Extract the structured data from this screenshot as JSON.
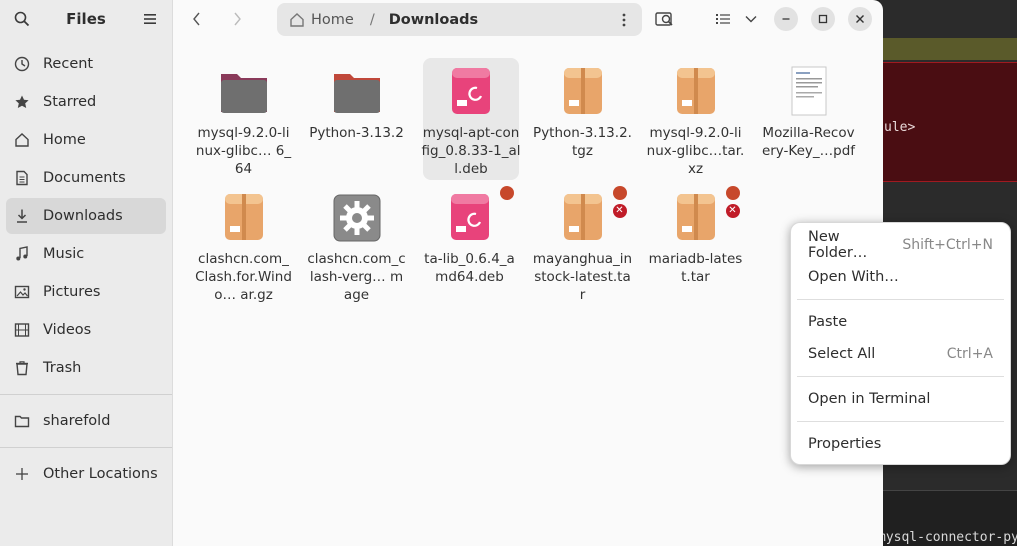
{
  "app": {
    "title": "Files"
  },
  "sidebar": {
    "items": [
      {
        "label": "Recent",
        "icon": "clock-icon"
      },
      {
        "label": "Starred",
        "icon": "star-icon"
      },
      {
        "label": "Home",
        "icon": "home-icon"
      },
      {
        "label": "Documents",
        "icon": "document-icon"
      },
      {
        "label": "Downloads",
        "icon": "download-icon",
        "active": true
      },
      {
        "label": "Music",
        "icon": "music-icon"
      },
      {
        "label": "Pictures",
        "icon": "picture-icon"
      },
      {
        "label": "Videos",
        "icon": "video-icon"
      },
      {
        "label": "Trash",
        "icon": "trash-icon"
      }
    ],
    "bookmarks": [
      {
        "label": "sharefold",
        "icon": "folder-icon"
      }
    ],
    "other": {
      "label": "Other Locations",
      "icon": "plus-icon"
    }
  },
  "path": {
    "home": "Home",
    "separator": "/",
    "current": "Downloads"
  },
  "files": [
    {
      "name": "mysql-9.2.0-linux-glibc… 6_64",
      "icon": "folder-icon",
      "type": "folder"
    },
    {
      "name": "Python-3.13.2",
      "icon": "folder-icon",
      "type": "folder"
    },
    {
      "name": "mysql-apt-config_0.8.33-1_all.deb",
      "icon": "deb-package-icon",
      "type": "deb",
      "selected": true
    },
    {
      "name": "Python-3.13.2.tgz",
      "icon": "archive-icon",
      "type": "archive"
    },
    {
      "name": "mysql-9.2.0-linux-glibc…tar.xz",
      "icon": "archive-icon",
      "type": "archive"
    },
    {
      "name": "Mozilla-Recovery-Key_…pdf",
      "icon": "pdf-document-icon",
      "type": "pdf"
    },
    {
      "name": "clashcn.com_Clash.for.Windo… ar.gz",
      "icon": "archive-icon",
      "type": "archive"
    },
    {
      "name": "clashcn.com_clash-verg… mage",
      "icon": "executable-gear-icon",
      "type": "exec"
    },
    {
      "name": "ta-lib_0.6.4_amd64.deb",
      "icon": "deb-package-icon",
      "type": "deb",
      "locked": true
    },
    {
      "name": "mayanghua_instock-latest.tar",
      "icon": "archive-icon",
      "type": "archive",
      "locked": true,
      "unreadable": true
    },
    {
      "name": "mariadb-latest.tar",
      "icon": "archive-icon",
      "type": "archive",
      "locked": true,
      "unreadable": true
    }
  ],
  "context_menu": {
    "new_folder": "New Folder…",
    "new_folder_accel": "Shift+Ctrl+N",
    "open_with": "Open With…",
    "paste": "Paste",
    "select_all": "Select All",
    "select_all_accel": "Ctrl+A",
    "open_terminal": "Open in Terminal",
    "properties": "Properties"
  },
  "terminal": {
    "line1": "ule>",
    "line2": "mysql-connector-py"
  },
  "colors": {
    "folder": "#6f6f6f",
    "archive": "#e8a56a",
    "deb": "#e8437b",
    "lock": "#c7482b",
    "error": "#c01c28"
  }
}
